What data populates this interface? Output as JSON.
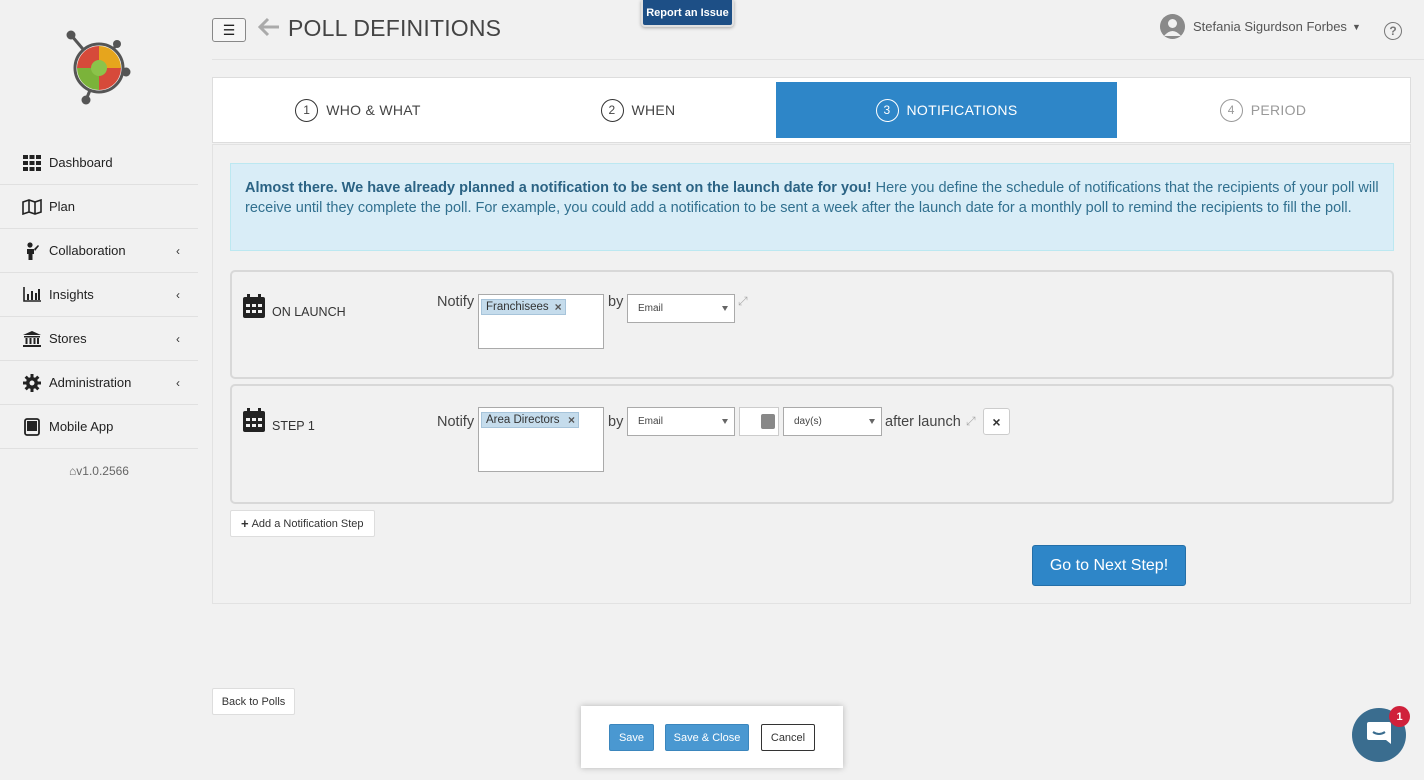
{
  "header": {
    "title": "POLL DEFINITIONS",
    "report_issue": "Report an Issue",
    "user_name": "Stefania Sigurdson Forbes",
    "help": "?"
  },
  "sidebar": {
    "items": [
      {
        "label": "Dashboard",
        "icon": "grid-icon"
      },
      {
        "label": "Plan",
        "icon": "map-icon"
      },
      {
        "label": "Collaboration",
        "icon": "person-icon"
      },
      {
        "label": "Insights",
        "icon": "bar-chart-icon"
      },
      {
        "label": "Stores",
        "icon": "bank-icon"
      },
      {
        "label": "Administration",
        "icon": "gear-icon"
      },
      {
        "label": "Mobile App",
        "icon": "tablet-icon"
      }
    ],
    "version": "v1.0.2566"
  },
  "wizard": {
    "tabs": [
      {
        "num": "1",
        "label": "WHO & WHAT"
      },
      {
        "num": "2",
        "label": "WHEN"
      },
      {
        "num": "3",
        "label": "NOTIFICATIONS"
      },
      {
        "num": "4",
        "label": "PERIOD"
      }
    ],
    "active_index": 2
  },
  "alert": {
    "bold": "Almost there. We have already planned a notification to be sent on the launch date for you!",
    "text": " Here you define the schedule of notifications that the recipients of your poll will receive until they complete the poll. For example, you could add a notification to be sent a week after the launch date for a monthly poll to remind the recipients to fill the poll."
  },
  "steps": [
    {
      "label": "ON LAUNCH",
      "notify_label": "Notify",
      "recipient": "Franchisees",
      "by_label": "by",
      "channel": "Email"
    },
    {
      "label": "STEP 1",
      "notify_label": "Notify",
      "recipient": "Area Directors",
      "by_label": "by",
      "channel": "Email",
      "unit": "day(s)",
      "after_label": "after launch",
      "delete": "×"
    }
  ],
  "actions": {
    "add_step": "Add a Notification Step",
    "next": "Go to Next Step!",
    "back_to_polls": "Back to Polls",
    "save": "Save",
    "save_close": "Save & Close",
    "cancel": "Cancel"
  },
  "chat": {
    "badge_count": "1"
  },
  "colors": {
    "primary": "#2e86c8",
    "alert_bg": "#d9edf7",
    "alert_text": "#31708f",
    "badge": "#d0213b"
  }
}
